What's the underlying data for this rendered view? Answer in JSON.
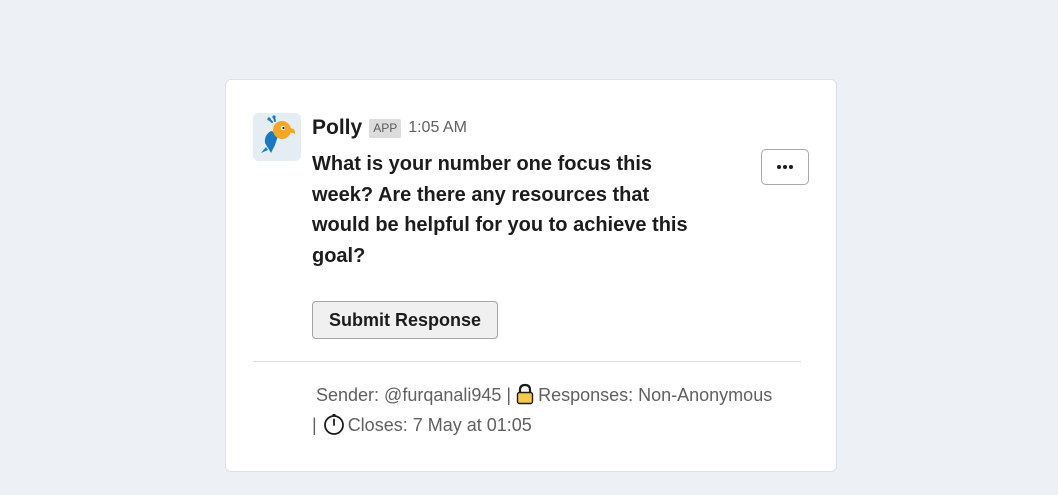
{
  "message": {
    "app_name": "Polly",
    "badge": "APP",
    "timestamp": "1:05 AM",
    "question": "What is your number one focus this week? Are there any resources that would be helpful for you to achieve this goal?",
    "more_icon": "ellipsis-icon",
    "submit_label": "Submit Response",
    "footer": {
      "sender_text": "Sender: @furqanali945 |",
      "responses_icon": "lock-icon",
      "responses_text": "Responses: Non-Anonymous",
      "separator": "|",
      "closes_icon": "stopwatch-icon",
      "closes_text": "Closes: 7 May at 01:05"
    }
  },
  "colors": {
    "page_background": "#edf1f5",
    "card_background": "#ffffff",
    "brand_blue": "#1a78c2",
    "brand_orange": "#f5a623",
    "lock_yellow": "#f7c948"
  }
}
